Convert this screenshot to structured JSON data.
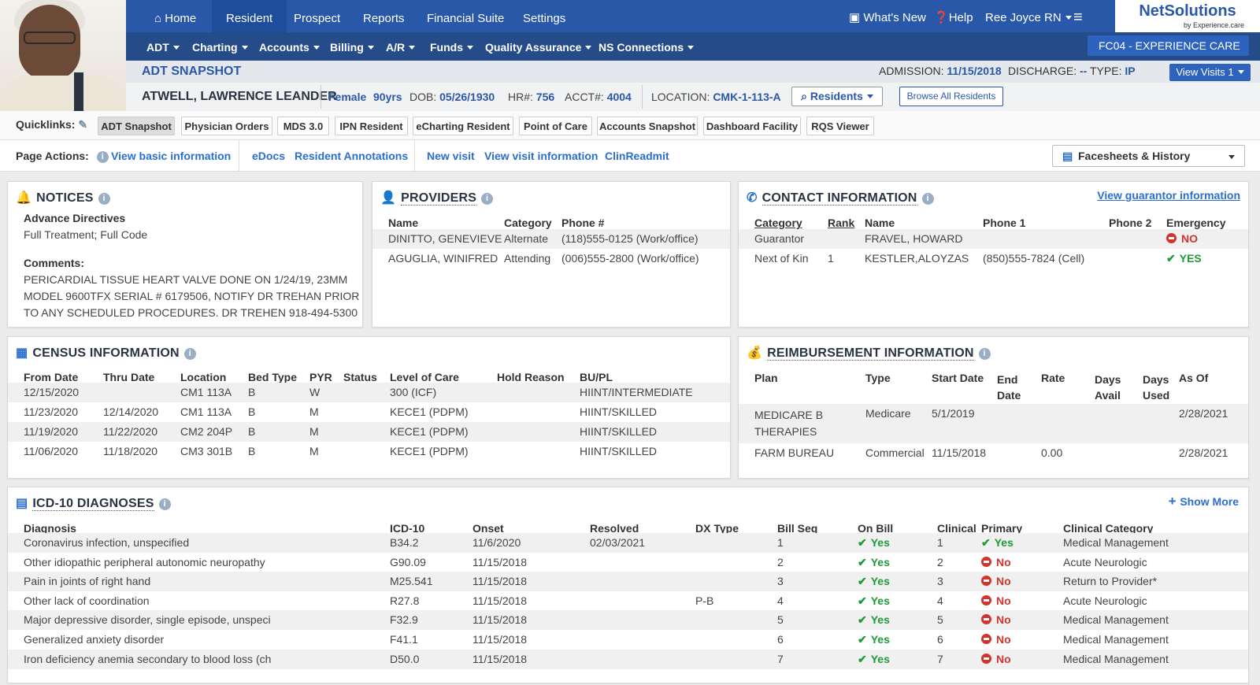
{
  "nav": {
    "tabs": [
      "Home",
      "Resident",
      "Prospect",
      "Reports",
      "Financial Suite",
      "Settings"
    ],
    "active_tab": "Resident",
    "whats_new": "What's New",
    "help": "Help",
    "user": "Ree Joyce RN",
    "logo_main": "NetSolutions",
    "logo_sub": "by Experience.care"
  },
  "menu": {
    "items": [
      "ADT",
      "Charting",
      "Accounts",
      "Billing",
      "A/R",
      "Funds",
      "Quality Assurance",
      "NS Connections"
    ],
    "facility": "FC04 - EXPERIENCE CARE"
  },
  "snapshot": {
    "title": "ADT SNAPSHOT",
    "admission_label": "ADMISSION:",
    "admission": "11/15/2018",
    "discharge_label": "DISCHARGE:",
    "discharge": "--",
    "type_label": "TYPE:",
    "type": "IP",
    "view_visits": "View Visits 1"
  },
  "resident": {
    "name": "ATWELL, LAWRENCE LEANDER",
    "sex": "Female",
    "age": "90yrs",
    "dob_label": "DOB:",
    "dob": "05/26/1930",
    "hr_label": "HR#:",
    "hr": "756",
    "acct_label": "ACCT#:",
    "acct": "4004",
    "location_label": "LOCATION:",
    "location": "CMK-1-113-A",
    "residents_btn": "Residents",
    "browse_btn": "Browse All Residents"
  },
  "quicklinks": {
    "label": "Quicklinks:",
    "items": [
      "ADT Snapshot",
      "Physician Orders",
      "MDS 3.0",
      "IPN Resident",
      "eCharting Resident",
      "Point of Care",
      "Accounts Snapshot",
      "Dashboard Facility",
      "RQS Viewer"
    ]
  },
  "page_actions": {
    "label": "Page Actions:",
    "links": [
      "View basic information",
      "eDocs",
      "Resident Annotations",
      "New visit",
      "View visit information",
      "ClinReadmit"
    ],
    "facesheets": "Facesheets & History"
  },
  "notices": {
    "title": "NOTICES",
    "advance_label": "Advance Directives",
    "advance_value": "Full Treatment; Full Code",
    "comments_label": "Comments:",
    "comment_lines": [
      "PERICARDIAL TISSUE HEART VALVE DONE ON 1/24/19, 23MM",
      "MODEL 9600TFX SERIAL # 6179506, NOTIFY DR TREHAN PRIOR",
      "TO ANY SCHEDULED PROCEDURES. DR TREHEN 918-494-5300"
    ]
  },
  "providers": {
    "title": "PROVIDERS",
    "headers": [
      "Name",
      "Category",
      "Phone #"
    ],
    "rows": [
      [
        "DINITTO, GENEVIEVE",
        "Alternate",
        "(118)555-0125 (Work/office)"
      ],
      [
        "AGUGLIA, WINIFRED",
        "Attending",
        "(006)555-2800 (Work/office)"
      ]
    ]
  },
  "contact": {
    "title": "CONTACT INFORMATION",
    "guarantor_link": "View guarantor information",
    "headers": [
      "Category",
      "Rank",
      "Name",
      "Phone 1",
      "Phone 2",
      "Emergency"
    ],
    "rows": [
      [
        "Guarantor",
        "",
        "FRAVEL, HOWARD",
        "",
        "",
        "NO"
      ],
      [
        "Next of Kin",
        "1",
        "KESTLER,ALOYZAS",
        "(850)555-7824 (Cell)",
        "",
        "YES"
      ]
    ]
  },
  "census": {
    "title": "CENSUS INFORMATION",
    "headers": [
      "From Date",
      "Thru Date",
      "Location",
      "Bed Type",
      "PYR",
      "Status",
      "Level of Care",
      "Hold Reason",
      "BU/PL"
    ],
    "rows": [
      [
        "12/15/2020",
        "",
        "CM1 113A",
        "B",
        "W",
        "",
        "300 (ICF)",
        "",
        "HIINT/INTERMEDIATE"
      ],
      [
        "11/23/2020",
        "12/14/2020",
        "CM1 113A",
        "B",
        "M",
        "",
        "KECE1 (PDPM)",
        "",
        "HIINT/SKILLED"
      ],
      [
        "11/19/2020",
        "11/22/2020",
        "CM2 204P",
        "B",
        "M",
        "",
        "KECE1 (PDPM)",
        "",
        "HIINT/SKILLED"
      ],
      [
        "11/06/2020",
        "11/18/2020",
        "CM3 301B",
        "B",
        "M",
        "",
        "KECE1 (PDPM)",
        "",
        "HIINT/SKILLED"
      ]
    ]
  },
  "reimbursement": {
    "title": "REIMBURSEMENT INFORMATION",
    "headers": [
      "Plan",
      "Type",
      "Start Date",
      "End Date",
      "Rate",
      "Days Avail",
      "Days Used",
      "As Of"
    ],
    "rows": [
      [
        "MEDICARE B THERAPIES",
        "Medicare",
        "5/1/2019",
        "",
        "",
        "",
        "",
        "2/28/2021"
      ],
      [
        "FARM BUREAU",
        "Commercial",
        "11/15/2018",
        "",
        "0.00",
        "",
        "",
        "2/28/2021"
      ]
    ]
  },
  "diagnoses": {
    "title": "ICD-10 DIAGNOSES",
    "show_more": "Show More",
    "headers": [
      "Diagnosis",
      "ICD-10",
      "Onset",
      "Resolved",
      "DX Type",
      "Bill Seq",
      "On Bill",
      "Clinical",
      "Primary",
      "Clinical Category"
    ],
    "rows": [
      [
        "Coronavirus infection, unspecified",
        "B34.2",
        "11/6/2020",
        "02/03/2021",
        "",
        "1",
        "Yes",
        "1",
        "Yes",
        "Medical Management"
      ],
      [
        "Other idiopathic peripheral autonomic neuropathy",
        "G90.09",
        "11/15/2018",
        "",
        "",
        "2",
        "Yes",
        "2",
        "No",
        "Acute Neurologic"
      ],
      [
        "Pain in joints of right hand",
        "M25.541",
        "11/15/2018",
        "",
        "",
        "3",
        "Yes",
        "3",
        "No",
        "Return to Provider*"
      ],
      [
        "Other lack of coordination",
        "R27.8",
        "11/15/2018",
        "",
        "P-B",
        "4",
        "Yes",
        "4",
        "No",
        "Acute Neurologic"
      ],
      [
        "Major depressive disorder, single episode, unspeci",
        "F32.9",
        "11/15/2018",
        "",
        "",
        "5",
        "Yes",
        "5",
        "No",
        "Medical Management"
      ],
      [
        "Generalized anxiety disorder",
        "F41.1",
        "11/15/2018",
        "",
        "",
        "6",
        "Yes",
        "6",
        "No",
        "Medical Management"
      ],
      [
        "Iron deficiency anemia secondary to blood loss (ch",
        "D50.0",
        "11/15/2018",
        "",
        "",
        "7",
        "Yes",
        "7",
        "No",
        "Medical Management"
      ]
    ]
  }
}
